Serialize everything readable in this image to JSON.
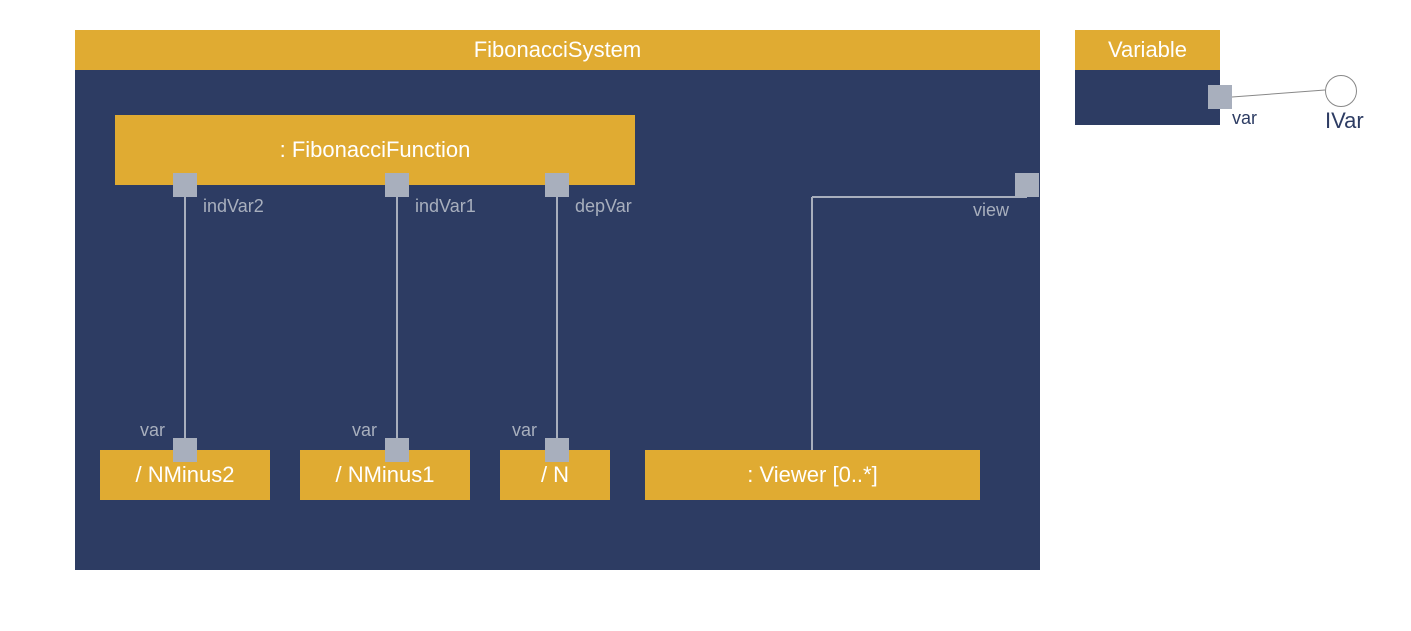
{
  "fibSystem": {
    "title": "FibonacciSystem",
    "function": {
      "label": ": FibonacciFunction",
      "ports": {
        "indVar2": "indVar2",
        "indVar1": "indVar1",
        "depVar": "depVar"
      }
    },
    "viewPortLabel": "view",
    "parts": {
      "nMinus2": {
        "label": "/ NMinus2",
        "portLabel": "var"
      },
      "nMinus1": {
        "label": "/ NMinus1",
        "portLabel": "var"
      },
      "n": {
        "label": "/ N",
        "portLabel": "var"
      },
      "viewer": {
        "label": ": Viewer [0..*]"
      }
    }
  },
  "variable": {
    "title": "Variable",
    "portLabel": "var",
    "interfaceLabel": "IVar"
  }
}
